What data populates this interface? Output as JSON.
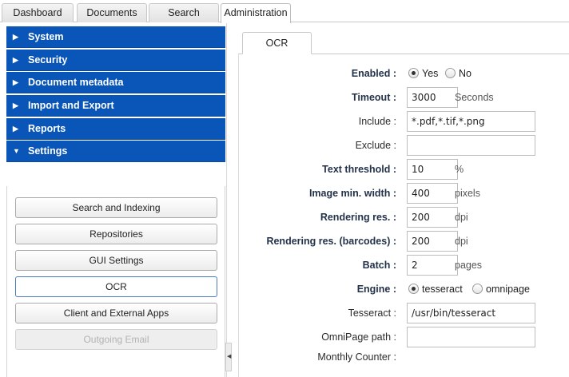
{
  "top_tabs": [
    {
      "label": "Dashboard"
    },
    {
      "label": "Documents"
    },
    {
      "label": "Search"
    },
    {
      "label": "Administration",
      "active": true
    }
  ],
  "sidebar": {
    "sections": [
      {
        "label": "System",
        "expanded": false
      },
      {
        "label": "Security",
        "expanded": false
      },
      {
        "label": "Document metadata",
        "expanded": false
      },
      {
        "label": "Import and Export",
        "expanded": false
      },
      {
        "label": "Reports",
        "expanded": false
      },
      {
        "label": "Settings",
        "expanded": true
      }
    ],
    "settings_buttons": [
      {
        "label": "Search and Indexing"
      },
      {
        "label": "Repositories"
      },
      {
        "label": "GUI Settings"
      },
      {
        "label": "OCR",
        "selected": true
      },
      {
        "label": "Client and External Apps"
      },
      {
        "label": "Outgoing Email",
        "disabled": true
      }
    ]
  },
  "ocr": {
    "tab_label": "OCR",
    "enabled": {
      "label": "Enabled :",
      "options": [
        "Yes",
        "No"
      ],
      "selected": "Yes"
    },
    "timeout": {
      "label": "Timeout :",
      "value": "3000",
      "unit": "Seconds"
    },
    "include": {
      "label": "Include :",
      "value": "*.pdf,*.tif,*.png"
    },
    "exclude": {
      "label": "Exclude :",
      "value": ""
    },
    "text_threshold": {
      "label": "Text threshold :",
      "value": "10",
      "unit": "%"
    },
    "image_min_width": {
      "label": "Image min. width :",
      "value": "400",
      "unit": "pixels"
    },
    "rendering_res": {
      "label": "Rendering res. :",
      "value": "200",
      "unit": "dpi"
    },
    "rendering_res_barcodes": {
      "label": "Rendering res. (barcodes) :",
      "value": "200",
      "unit": "dpi"
    },
    "batch": {
      "label": "Batch :",
      "value": "2",
      "unit": "pages"
    },
    "engine": {
      "label": "Engine :",
      "options": [
        "tesseract",
        "omnipage"
      ],
      "selected": "tesseract"
    },
    "tesseract": {
      "label": "Tesseract :",
      "value": "/usr/bin/tesseract"
    },
    "omnipage_path": {
      "label": "OmniPage path :",
      "value": ""
    },
    "monthly_counter": {
      "label": "Monthly Counter :",
      "value": ""
    }
  },
  "colors": {
    "accordion_header": "#0a56b8",
    "label_bold": "#23324a"
  }
}
